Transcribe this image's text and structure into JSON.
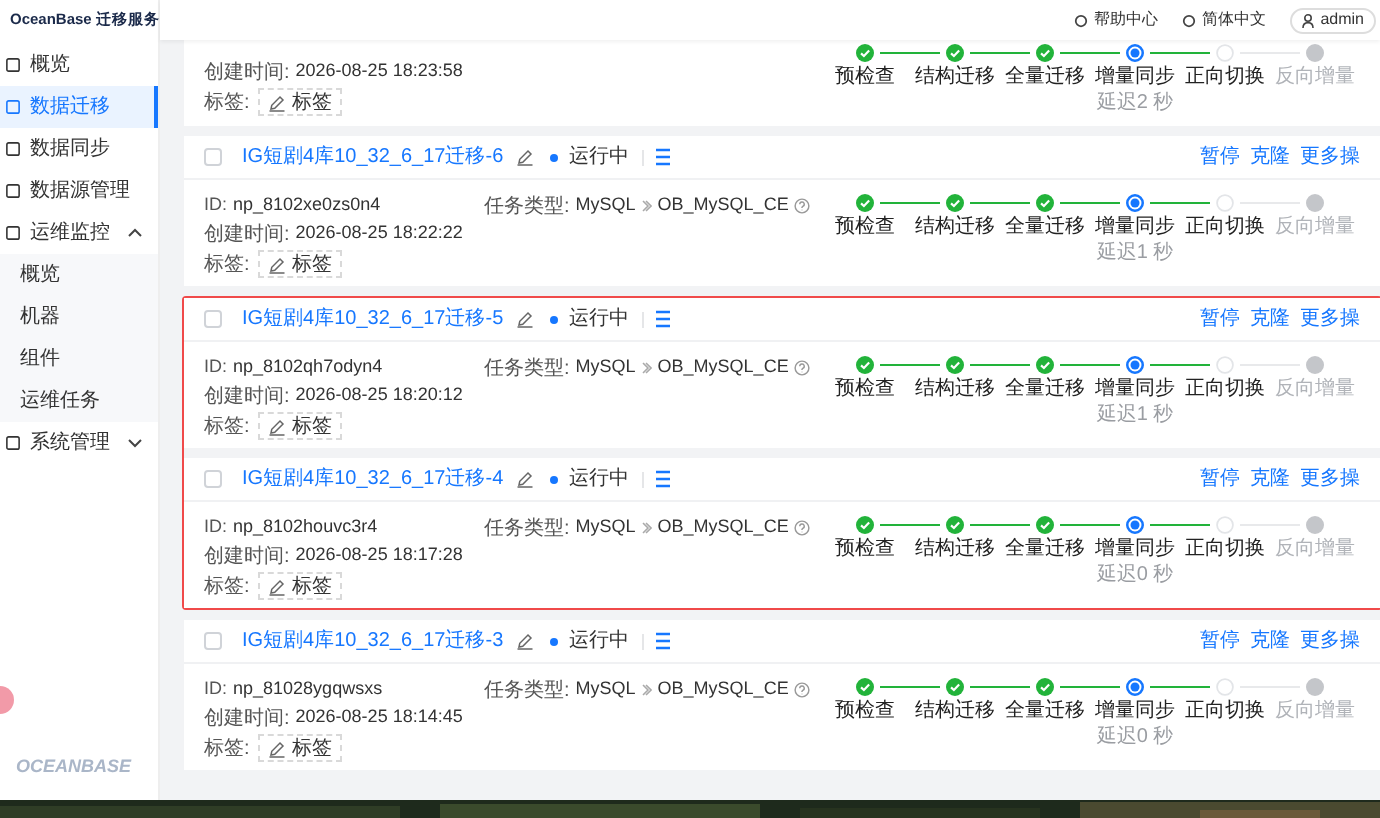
{
  "app": {
    "logo": "OceanBase 迁移服务",
    "footer_logo": "OCEANBASE"
  },
  "sidebar": {
    "items": [
      {
        "label": "概览",
        "selected": false
      },
      {
        "label": "数据迁移",
        "selected": true
      },
      {
        "label": "数据同步",
        "selected": false
      },
      {
        "label": "数据源管理",
        "selected": false
      },
      {
        "label": "运维监控",
        "selected": false,
        "expanded": true,
        "children": [
          {
            "label": "概览",
            "selected": false
          },
          {
            "label": "机器",
            "selected": false
          },
          {
            "label": "组件",
            "selected": false
          },
          {
            "label": "运维任务",
            "selected": false
          }
        ]
      },
      {
        "label": "系统管理",
        "selected": false,
        "expanded": false
      }
    ]
  },
  "header": {
    "links": [
      "帮助中心",
      "简体中文"
    ],
    "user": "admin"
  },
  "tasks": [
    {
      "kind": "partial",
      "highlighted": false,
      "created_label": "创建时间:",
      "created": "2026-08-25 18:23:58",
      "tag_label": "标签:",
      "tag_button": "标签",
      "steps": [
        {
          "label": "预检查",
          "done": true,
          "current": false,
          "disabled": false
        },
        {
          "label": "结构迁移",
          "done": true,
          "current": false,
          "disabled": false
        },
        {
          "label": "全量迁移",
          "done": true,
          "current": false,
          "disabled": false
        },
        {
          "label": "增量同步",
          "done": false,
          "current": true,
          "disabled": false,
          "note": "延迟2 秒"
        },
        {
          "label": "正向切换",
          "done": false,
          "current": false,
          "disabled": false
        },
        {
          "label": "反向增量",
          "done": false,
          "current": false,
          "disabled": true
        }
      ]
    },
    {
      "kind": "full",
      "highlighted": false,
      "checked": false,
      "name": "IG短剧4库10_32_6_17迁移-6",
      "status": "运行中",
      "actions": [
        "暂停",
        "克隆",
        "更多操"
      ],
      "id_label": "ID:",
      "id": "np_8102xe0zs0n4",
      "type_label": "任务类型:",
      "source": "MySQL",
      "target": "OB_MySQL_CE",
      "created_label": "创建时间:",
      "created": "2026-08-25 18:22:22",
      "tag_label": "标签:",
      "tag_button": "标签",
      "steps": [
        {
          "label": "预检查",
          "done": true,
          "current": false,
          "disabled": false
        },
        {
          "label": "结构迁移",
          "done": true,
          "current": false,
          "disabled": false
        },
        {
          "label": "全量迁移",
          "done": true,
          "current": false,
          "disabled": false
        },
        {
          "label": "增量同步",
          "done": false,
          "current": true,
          "disabled": false,
          "note": "延迟1 秒"
        },
        {
          "label": "正向切换",
          "done": false,
          "current": false,
          "disabled": false
        },
        {
          "label": "反向增量",
          "done": false,
          "current": false,
          "disabled": true
        }
      ]
    },
    {
      "kind": "full",
      "highlighted": true,
      "checked": false,
      "name": "IG短剧4库10_32_6_17迁移-5",
      "status": "运行中",
      "actions": [
        "暂停",
        "克隆",
        "更多操"
      ],
      "id_label": "ID:",
      "id": "np_8102qh7odyn4",
      "type_label": "任务类型:",
      "source": "MySQL",
      "target": "OB_MySQL_CE",
      "created_label": "创建时间:",
      "created": "2026-08-25 18:20:12",
      "tag_label": "标签:",
      "tag_button": "标签",
      "steps": [
        {
          "label": "预检查",
          "done": true,
          "current": false,
          "disabled": false
        },
        {
          "label": "结构迁移",
          "done": true,
          "current": false,
          "disabled": false
        },
        {
          "label": "全量迁移",
          "done": true,
          "current": false,
          "disabled": false
        },
        {
          "label": "增量同步",
          "done": false,
          "current": true,
          "disabled": false,
          "note": "延迟1 秒"
        },
        {
          "label": "正向切换",
          "done": false,
          "current": false,
          "disabled": false
        },
        {
          "label": "反向增量",
          "done": false,
          "current": false,
          "disabled": true
        }
      ]
    },
    {
      "kind": "full",
      "highlighted": true,
      "checked": false,
      "name": "IG短剧4库10_32_6_17迁移-4",
      "status": "运行中",
      "actions": [
        "暂停",
        "克隆",
        "更多操"
      ],
      "id_label": "ID:",
      "id": "np_8102houvc3r4",
      "type_label": "任务类型:",
      "source": "MySQL",
      "target": "OB_MySQL_CE",
      "created_label": "创建时间:",
      "created": "2026-08-25 18:17:28",
      "tag_label": "标签:",
      "tag_button": "标签",
      "steps": [
        {
          "label": "预检查",
          "done": true,
          "current": false,
          "disabled": false
        },
        {
          "label": "结构迁移",
          "done": true,
          "current": false,
          "disabled": false
        },
        {
          "label": "全量迁移",
          "done": true,
          "current": false,
          "disabled": false
        },
        {
          "label": "增量同步",
          "done": false,
          "current": true,
          "disabled": false,
          "note": "延迟0 秒"
        },
        {
          "label": "正向切换",
          "done": false,
          "current": false,
          "disabled": false
        },
        {
          "label": "反向增量",
          "done": false,
          "current": false,
          "disabled": true
        }
      ]
    },
    {
      "kind": "full",
      "highlighted": false,
      "checked": false,
      "name": "IG短剧4库10_32_6_17迁移-3",
      "status": "运行中",
      "actions": [
        "暂停",
        "克隆",
        "更多操"
      ],
      "id_label": "ID:",
      "id": "np_81028ygqwsxs",
      "type_label": "任务类型:",
      "source": "MySQL",
      "target": "OB_MySQL_CE",
      "created_label": "创建时间:",
      "created": "2026-08-25 18:14:45",
      "tag_label": "标签:",
      "tag_button": "标签",
      "steps": [
        {
          "label": "预检查",
          "done": true,
          "current": false,
          "disabled": false
        },
        {
          "label": "结构迁移",
          "done": true,
          "current": false,
          "disabled": false
        },
        {
          "label": "全量迁移",
          "done": true,
          "current": false,
          "disabled": false
        },
        {
          "label": "增量同步",
          "done": false,
          "current": true,
          "disabled": false,
          "note": "延迟0 秒"
        },
        {
          "label": "正向切换",
          "done": false,
          "current": false,
          "disabled": false
        },
        {
          "label": "反向增量",
          "done": false,
          "current": false,
          "disabled": true
        }
      ]
    }
  ]
}
